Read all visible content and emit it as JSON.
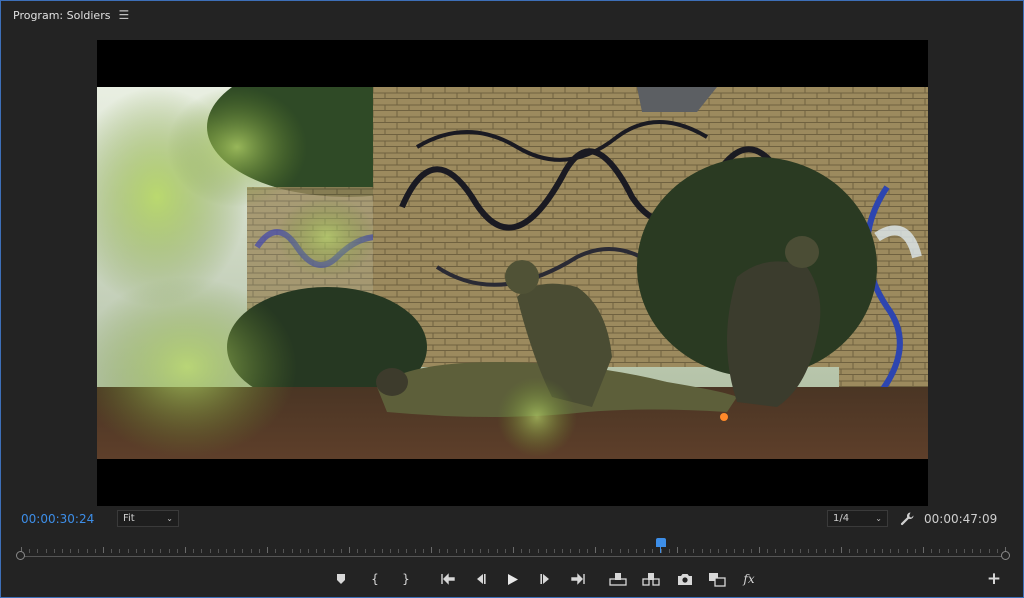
{
  "panel": {
    "title": "Program: Soldiers",
    "menu_icon": "hamburger-menu-icon"
  },
  "timecode": {
    "current": "00:00:30:24",
    "duration": "00:00:47:09"
  },
  "zoom": {
    "selected": "Fit"
  },
  "resolution": {
    "selected": "1/4"
  },
  "scrubber": {
    "playhead_position": 0.65
  },
  "colors": {
    "accent": "#3d8ee8",
    "border": "#3d6fb8",
    "panel_bg": "#232323"
  },
  "controls": {
    "buttons": [
      {
        "name": "add-marker",
        "icon": "marker-icon"
      },
      {
        "name": "mark-in",
        "glyph": "{"
      },
      {
        "name": "mark-out",
        "glyph": "}"
      },
      {
        "name": "go-to-in",
        "icon": "go-to-in-icon"
      },
      {
        "name": "step-back",
        "icon": "step-back-icon"
      },
      {
        "name": "play",
        "icon": "play-icon"
      },
      {
        "name": "step-forward",
        "icon": "step-forward-icon"
      },
      {
        "name": "go-to-out",
        "icon": "go-to-out-icon"
      },
      {
        "name": "lift",
        "icon": "lift-icon"
      },
      {
        "name": "extract",
        "icon": "extract-icon"
      },
      {
        "name": "export-frame",
        "icon": "camera-icon"
      },
      {
        "name": "comparison-view",
        "icon": "comparison-view-icon"
      },
      {
        "name": "effects",
        "glyph": "fx"
      },
      {
        "name": "button-editor",
        "glyph": "+"
      }
    ]
  }
}
